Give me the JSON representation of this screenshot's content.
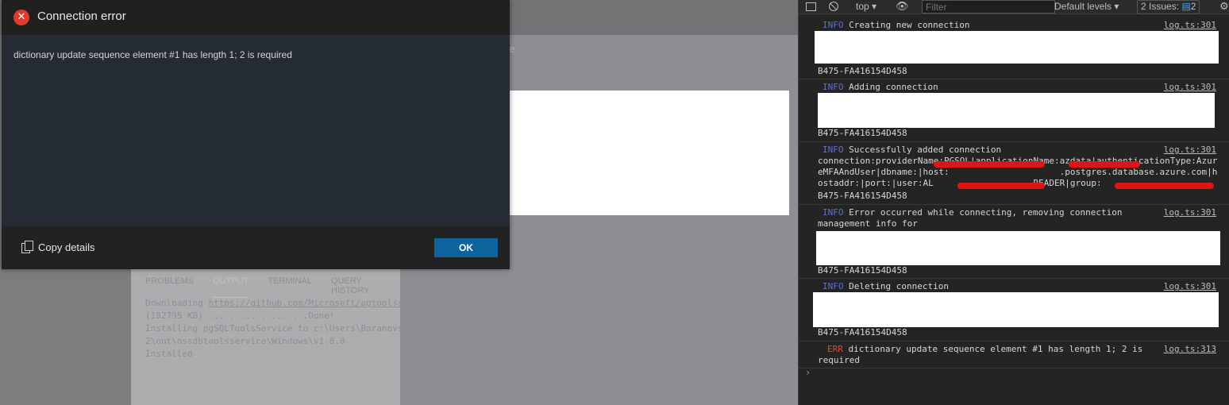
{
  "dialog": {
    "title": "Connection error",
    "message": "dictionary update sequence element #1 has length 1; 2 is required",
    "copy_label": "Copy details",
    "ok_label": "OK"
  },
  "background": {
    "ghost_text": "e",
    "panel_tabs": [
      "PROBLEMS",
      "OUTPUT",
      "TERMINAL",
      "QUERY HISTORY"
    ],
    "active_tab": "OUTPUT",
    "output": {
      "l1_prefix": "Downloading ",
      "l1_link": "https://github.com/Microsoft/pgtoolss",
      "l2": "(182795 KB)....................Done!",
      "l3": "Installing pgSQLToolsService to c:\\Users\\Baranovs",
      "l4": "2\\out\\ossdbtoolsservice\\Windows\\v1.8.0",
      "l5": "Installed"
    }
  },
  "devtools": {
    "context": "top",
    "filter_placeholder": "Filter",
    "levels": "Default levels",
    "issues_label": "2 Issues:",
    "issues_count": "2",
    "entries": [
      {
        "level": "INFO",
        "text": "Creating new connection",
        "source": "log.ts:301",
        "tail": "B475-FA416154D458"
      },
      {
        "level": "INFO",
        "text": "Adding connection",
        "source": "log.ts:301",
        "tail": "B475-FA416154D458"
      },
      {
        "level": "INFO",
        "text": "Successfully added connection",
        "source": "log.ts:301",
        "body": "connection:providerName:PGSQL|applicationName:azdata|authenticationType:AzureMFAAndUser|dbname:|host:                     .postgres.database.azure.com|hostaddr:|port:|user:AL                   READER|group:                    -",
        "tail": "B475-FA416154D458"
      },
      {
        "level": "INFO",
        "text": "Error occurred while connecting, removing connection",
        "text2": "management info for",
        "source": "log.ts:301",
        "tail": "B475-FA416154D458"
      },
      {
        "level": "INFO",
        "text": "Deleting connection",
        "source": "log.ts:301",
        "tail": "B475-FA416154D458"
      },
      {
        "level": "ERR",
        "text": "dictionary update sequence element #1 has length 1; 2 is",
        "text2": "required",
        "source": "log.ts:313"
      }
    ],
    "prompt": "›"
  },
  "colors": {
    "ok_button": "#0e639c",
    "error_icon": "#e03a2e",
    "info": "#5b6ee0",
    "err": "#e04646"
  }
}
